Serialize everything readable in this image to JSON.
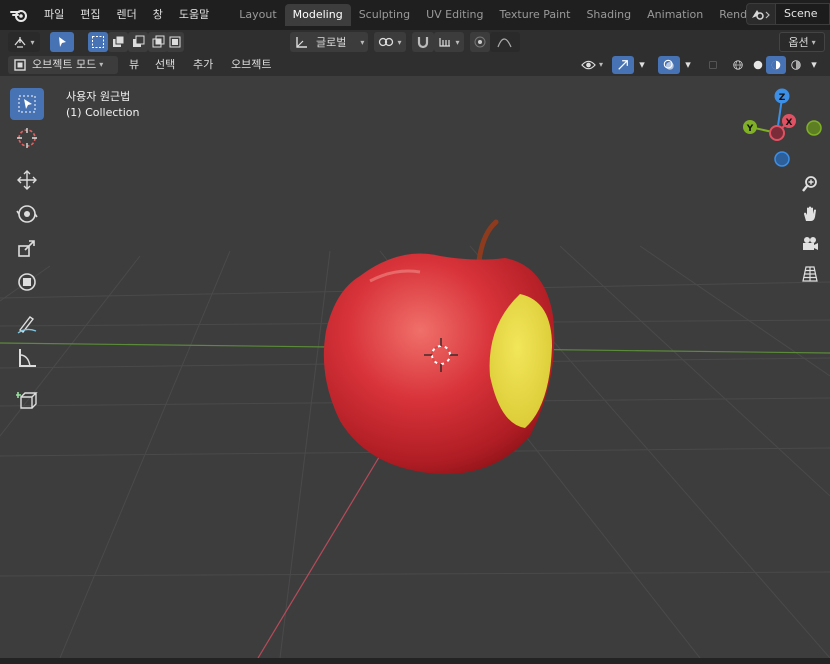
{
  "menu": {
    "items": [
      "파일",
      "편집",
      "렌더",
      "창",
      "도움말"
    ]
  },
  "workspaces": {
    "tabs": [
      "Layout",
      "Modeling",
      "Sculpting",
      "UV Editing",
      "Texture Paint",
      "Shading",
      "Animation",
      "Rend"
    ],
    "active_index": 1
  },
  "scene": {
    "name": "Scene"
  },
  "header1": {
    "transform_orientation": "글로벌",
    "options_label": "옵션"
  },
  "header2": {
    "mode": "오브젝트 모드",
    "view": "뷰",
    "select": "선택",
    "add": "추가",
    "object": "오브젝트"
  },
  "viewport": {
    "perspective_label": "사용자 원근법",
    "collection_label": "(1) Collection"
  },
  "gizmo": {
    "z_label": "Z",
    "x_label": "X",
    "y_label": "Y",
    "colors": {
      "x": "#e05263",
      "y": "#7fb026",
      "z": "#3c8fe6"
    }
  },
  "colors": {
    "accent": "#4772b3",
    "apple_red": "#d42a2a",
    "apple_flesh": "#e8d84a"
  }
}
